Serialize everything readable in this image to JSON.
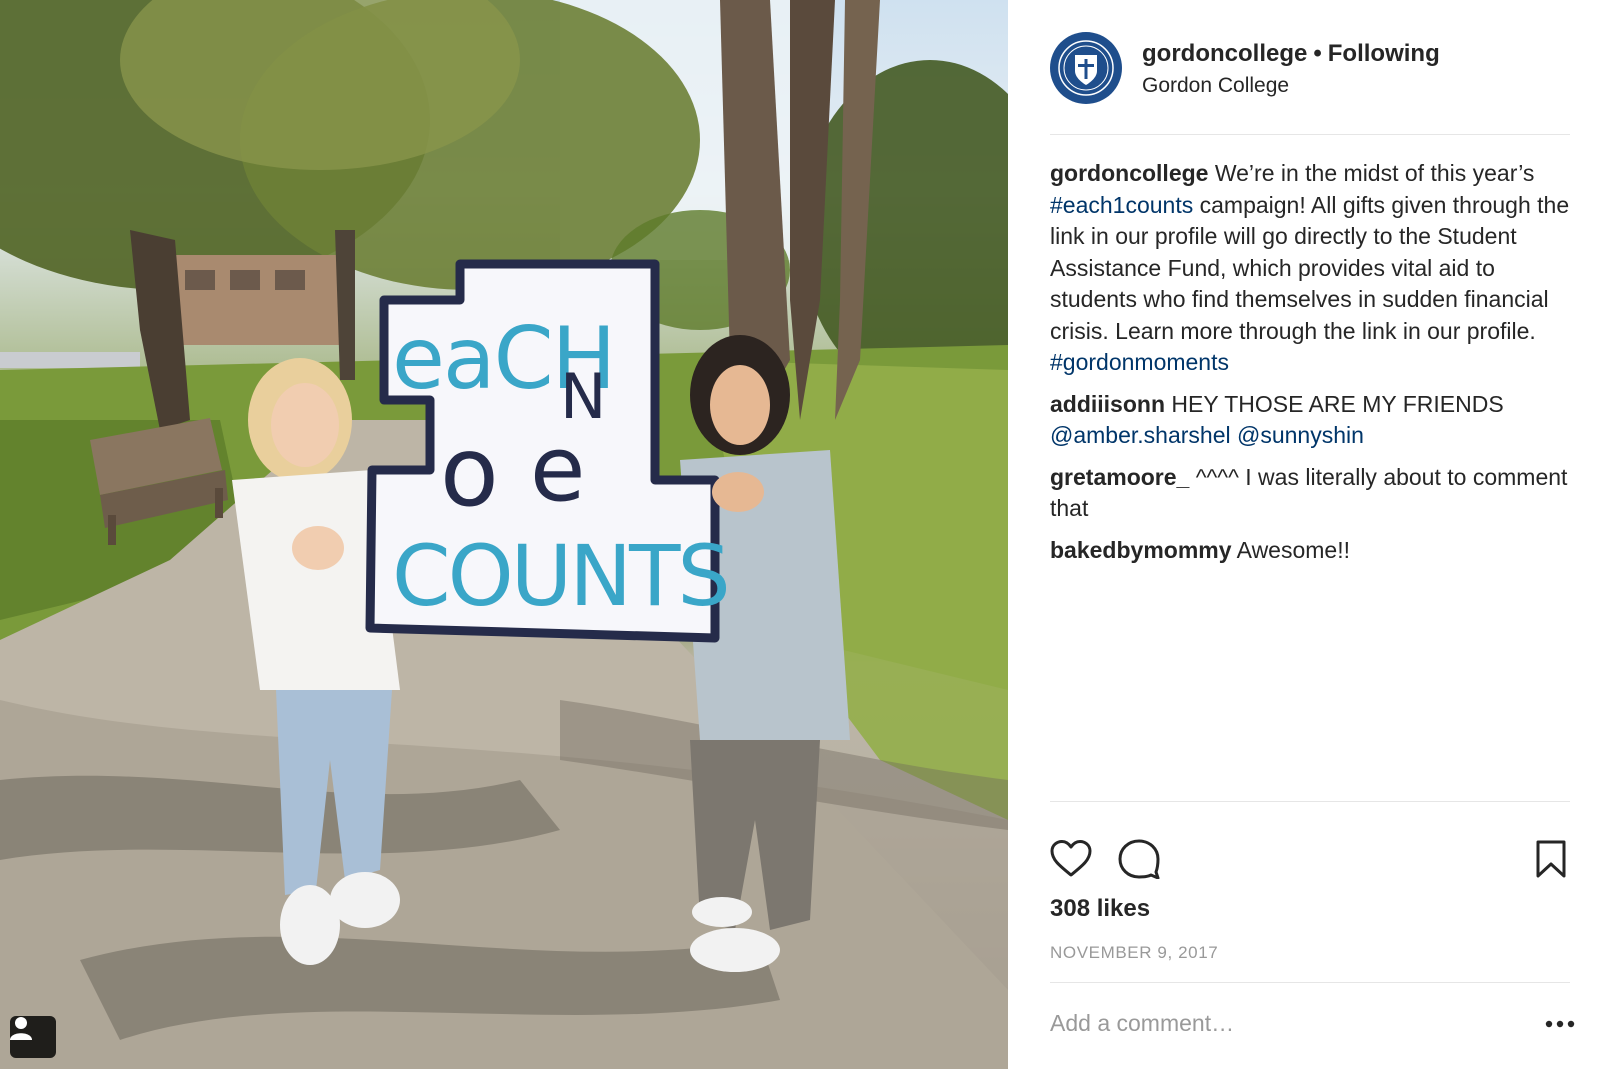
{
  "post": {
    "username": "gordoncollege",
    "follow_status": "Following",
    "location": "Gordon College",
    "avatar_icon": "college-seal-icon",
    "photo_alt_icon": "photo",
    "sign_text": "each one counts"
  },
  "comments": [
    {
      "user": "gordoncollege",
      "segments": [
        {
          "text": "We’re in the midst of this year’s ",
          "link": false
        },
        {
          "text": "#each1counts",
          "link": true
        },
        {
          "text": " campaign! All gifts given through the link in our profile will go directly to the Student Assistance Fund, which provides vital aid to students who find themselves in sudden financial crisis. Learn more through the link in our profile. ",
          "link": false
        },
        {
          "text": "#gordonmoments",
          "link": true
        }
      ]
    },
    {
      "user": "addiiisonn",
      "segments": [
        {
          "text": "HEY THOSE ARE MY FRIENDS ",
          "link": false
        },
        {
          "text": "@amber.sharshel",
          "link": true
        },
        {
          "text": " ",
          "link": false
        },
        {
          "text": "@sunnyshin",
          "link": true
        }
      ]
    },
    {
      "user": "gretamoore_",
      "segments": [
        {
          "text": "^^^^ I was literally about to comment that",
          "link": false
        }
      ]
    },
    {
      "user": "bakedbymommy",
      "segments": [
        {
          "text": "Awesome!!",
          "link": false
        }
      ]
    }
  ],
  "actions": {
    "like_icon": "heart-icon",
    "comment_icon": "comment-bubble-icon",
    "save_icon": "bookmark-icon",
    "tag_icon": "user-tag-icon",
    "more_icon": "more-options-icon"
  },
  "likes_text": "308 likes",
  "date_text": "NOVEMBER 9, 2017",
  "add_comment_placeholder": "Add a comment…",
  "colors": {
    "link": "#003569",
    "text": "#262626",
    "muted": "#999999",
    "divider": "#e6e6e6",
    "sign_teal": "#3aa6c8",
    "sign_navy": "#252b4a"
  }
}
